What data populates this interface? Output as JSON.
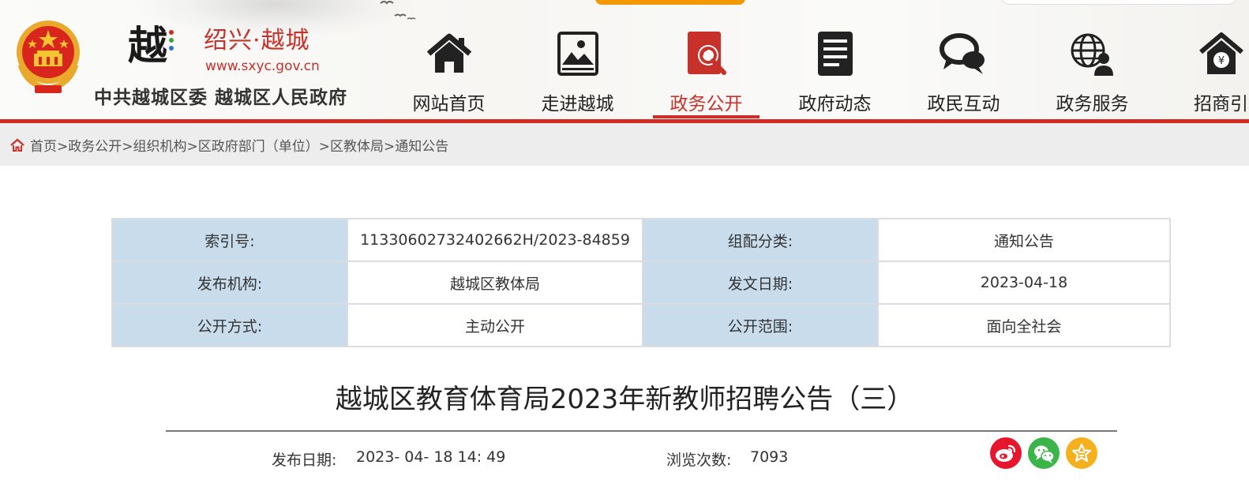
{
  "header": {
    "city_name": "绍兴·越城",
    "logo_char": "越",
    "url_text": "www.sxyc.gov.cn",
    "gov_name": "中共越城区委  越城区人民政府",
    "accent_color": "#c8302a"
  },
  "nav": {
    "items": [
      {
        "label": "网站首页",
        "icon": "home-icon"
      },
      {
        "label": "走进越城",
        "icon": "landscape-picture-icon"
      },
      {
        "label": "政务公开",
        "icon": "document-search-icon",
        "active": true
      },
      {
        "label": "政府动态",
        "icon": "news-document-icon"
      },
      {
        "label": "政民互动",
        "icon": "chat-bubbles-icon"
      },
      {
        "label": "政务服务",
        "icon": "globe-user-icon"
      },
      {
        "label": "招商引",
        "icon": "investment-house-icon"
      }
    ]
  },
  "breadcrumb": {
    "items": [
      "首页",
      "政务公开",
      "组织机构",
      "区政府部门（单位）",
      "区教体局",
      "通知公告"
    ],
    "separator": ">"
  },
  "meta": {
    "index_label": "索引号:",
    "index_value": "11330602732402662H/2023-84859",
    "category_label": "组配分类:",
    "category_value": "通知公告",
    "publisher_label": "发布机构:",
    "publisher_value": "越城区教体局",
    "doc_date_label": "发文日期:",
    "doc_date_value": "2023-04-18",
    "open_mode_label": "公开方式:",
    "open_mode_value": "主动公开",
    "open_scope_label": "公开范围:",
    "open_scope_value": "面向全社会"
  },
  "article": {
    "title": "越城区教育体育局2023年新教师招聘公告（三）",
    "publish_date_label": "发布日期:",
    "publish_date_value": "2023- 04- 18 14: 49",
    "views_label": "浏览次数:",
    "views_value": "7093"
  },
  "share": [
    {
      "name": "weibo-icon",
      "color": "#e6162d"
    },
    {
      "name": "wechat-icon",
      "color": "#3bb54a"
    },
    {
      "name": "favorite-star-icon",
      "color": "#f5b11d"
    }
  ]
}
